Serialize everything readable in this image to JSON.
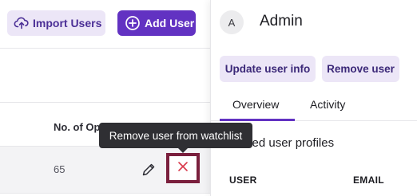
{
  "toolbar": {
    "import_label": "Import Users",
    "add_label": "Add User"
  },
  "table": {
    "column_header": "No. of Open Issues",
    "row": {
      "value": "65"
    }
  },
  "tooltip": {
    "text": "Remove user from watchlist"
  },
  "panel": {
    "avatar_initial": "A",
    "user_name": "Admin",
    "update_label": "Update user info",
    "remove_label": "Remove user",
    "tabs": [
      {
        "label": "Overview",
        "active": true
      },
      {
        "label": "Activity",
        "active": false
      }
    ],
    "section_title": "Linked user profiles",
    "columns": {
      "user": "USER",
      "email": "EMAIL"
    }
  },
  "colors": {
    "accent": "#6232c2",
    "accent_light": "#ece6f7",
    "highlight_border": "#7a1f3d",
    "remove_icon": "#d9384a",
    "tooltip_bg": "#2f2f33"
  },
  "icons": {
    "import": "cloud-upload-icon",
    "add": "plus-circle-icon",
    "edit": "pencil-icon",
    "remove": "close-icon"
  }
}
